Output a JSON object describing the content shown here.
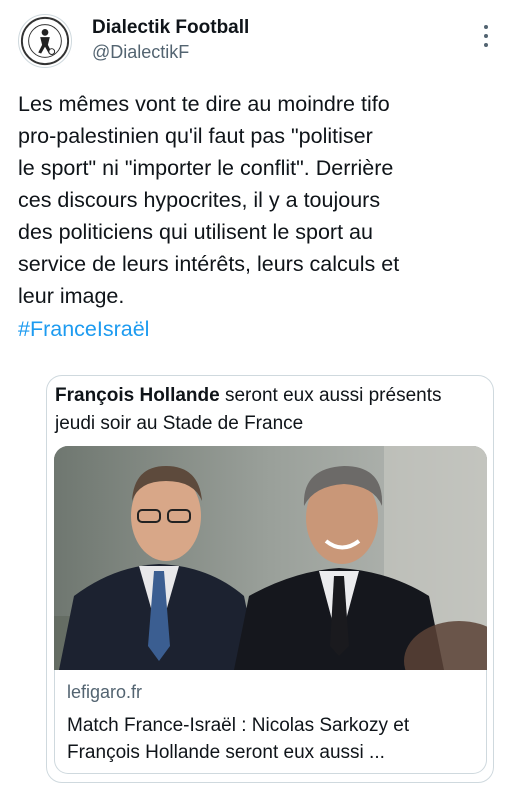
{
  "author": {
    "name": "Dialectik Football",
    "handle": "@DialectikF",
    "avatar_icon": "football-club-crest-icon"
  },
  "tweet": {
    "text": "Les mêmes vont te dire au moindre tifo\npro-palestinien qu'il faut pas \"politiser\nle sport\" ni \"importer le conflit\". Derrière\nces discours hypocrites, il y a toujours\ndes politiciens qui utilisent le sport au\nservice de leurs intérêts, leurs calculs et\nleur image.",
    "hashtag": "#FranceIsraël"
  },
  "card": {
    "quoted_bold": "François Hollande",
    "quoted_rest": " seront eux aussi présents jeudi soir au Stade de France",
    "domain": "lefigaro.fr",
    "title": "Match France-Israël : Nicolas Sarkozy et François Hollande seront eux aussi ..."
  },
  "colors": {
    "text": "#0f1419",
    "secondary": "#536471",
    "link": "#1d9bf0",
    "border": "#cfd9de"
  }
}
